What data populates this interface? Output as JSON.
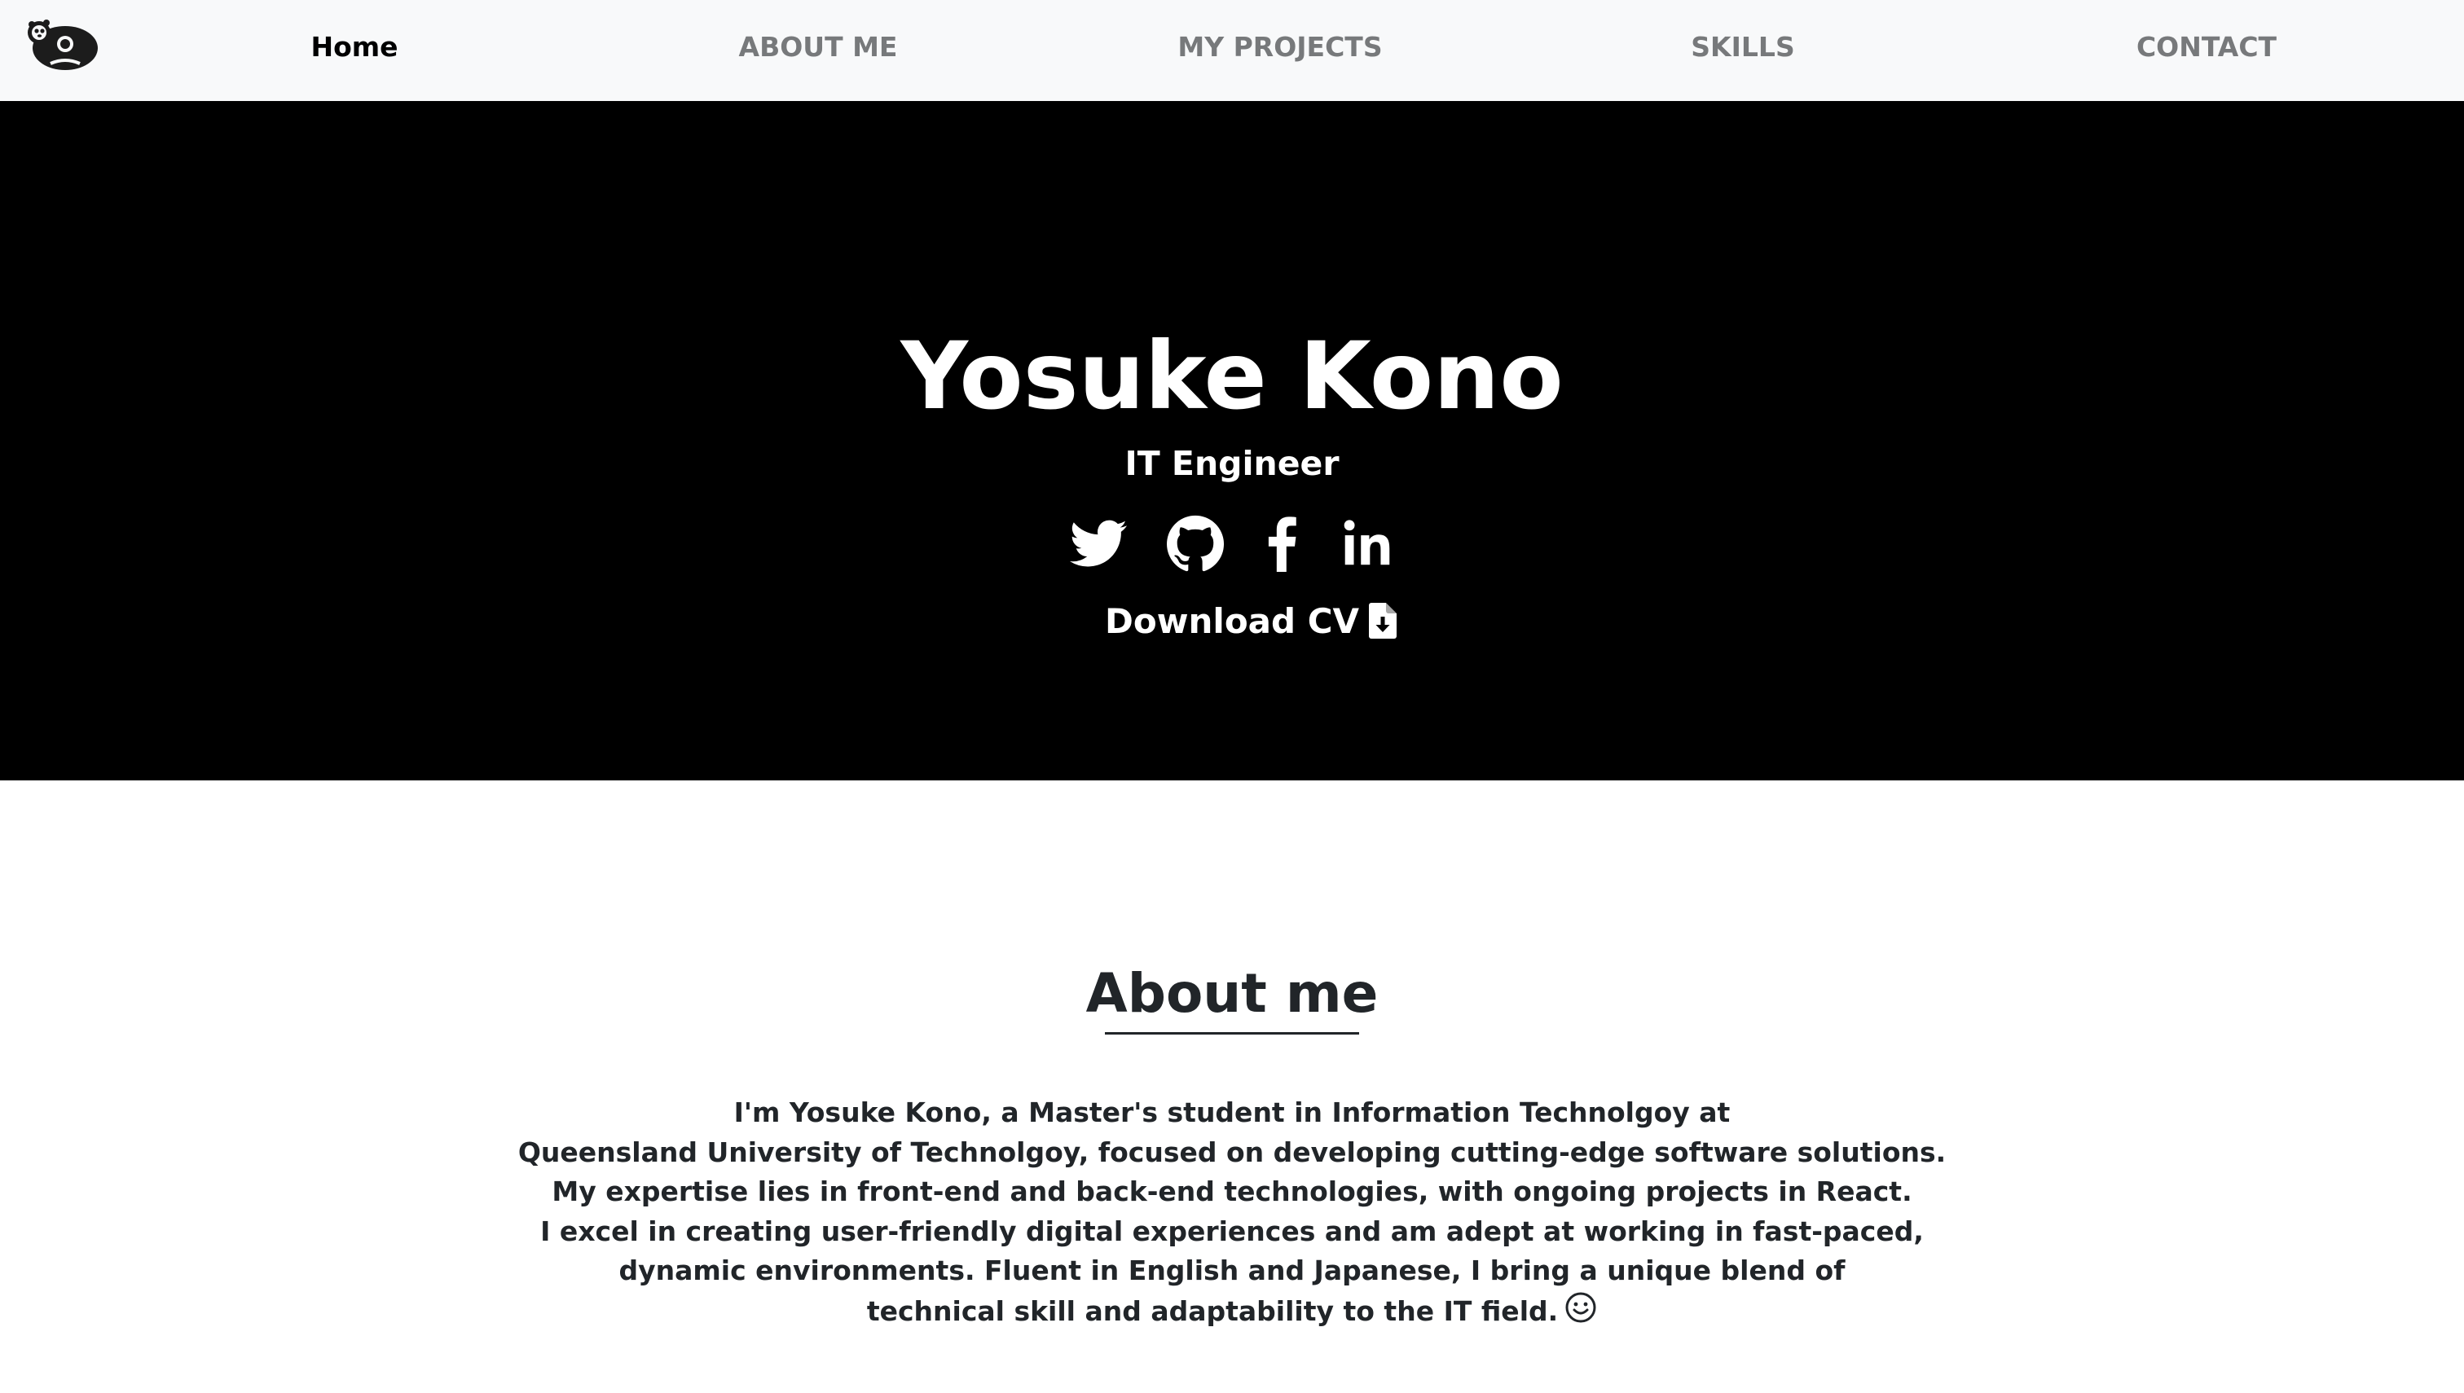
{
  "nav": {
    "logo": "otter-logo-icon",
    "items": [
      {
        "label": "Home",
        "active": true
      },
      {
        "label": "ABOUT ME",
        "active": false
      },
      {
        "label": "MY PROJECTS",
        "active": false
      },
      {
        "label": "SKILLS",
        "active": false
      },
      {
        "label": "CONTACT",
        "active": false
      }
    ]
  },
  "hero": {
    "name": "Yosuke Kono",
    "subtitle": "IT Engineer",
    "social_icons": [
      "twitter-icon",
      "github-icon",
      "facebook-icon",
      "linkedin-icon"
    ],
    "download_label": "Download CV",
    "download_icon": "file-download-icon"
  },
  "about": {
    "title": "About me",
    "lines": [
      "I'm Yosuke Kono, a Master's student in Information Technolgoy at",
      "Queensland University of Technolgoy, focused on developing cutting-edge software solutions.",
      "My expertise lies in front-end and back-end technologies, with ongoing projects in React.",
      "I excel in creating user-friendly digital experiences and am adept at working in fast-paced,",
      "dynamic environments. Fluent in English and Japanese, I bring a unique blend of",
      "technical skill and adaptability to the IT field."
    ],
    "end_icon": "smiley-icon"
  },
  "colors": {
    "navbar_bg": "#f8f9fa",
    "nav_inactive": "#77797b",
    "hero_bg": "#000000",
    "text_dark": "#212529"
  }
}
